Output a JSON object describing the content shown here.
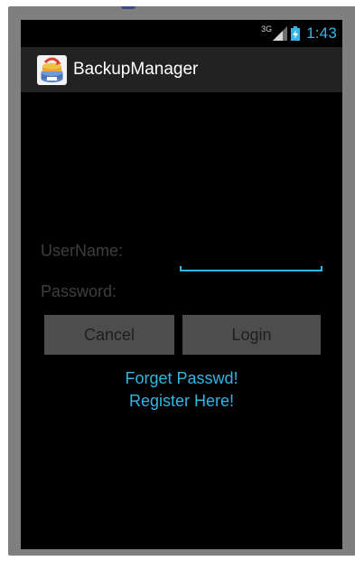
{
  "status_bar": {
    "network": "3G",
    "time": "1:43",
    "icons": [
      "signal-icon",
      "battery-charging-icon"
    ]
  },
  "action_bar": {
    "title": "BackupManager",
    "icon": "app-icon"
  },
  "form": {
    "username_label": "UserName:",
    "password_label": "Password:",
    "username_value": ""
  },
  "buttons": {
    "cancel": "Cancel",
    "login": "Login"
  },
  "links": {
    "forget_password": "Forget Passwd!",
    "register": "Register Here!"
  },
  "colors": {
    "accent": "#33b5e5",
    "background": "#000000",
    "action_bar": "#222222",
    "button": "#4d4d4d",
    "device_frame": "#7f7f7f"
  }
}
